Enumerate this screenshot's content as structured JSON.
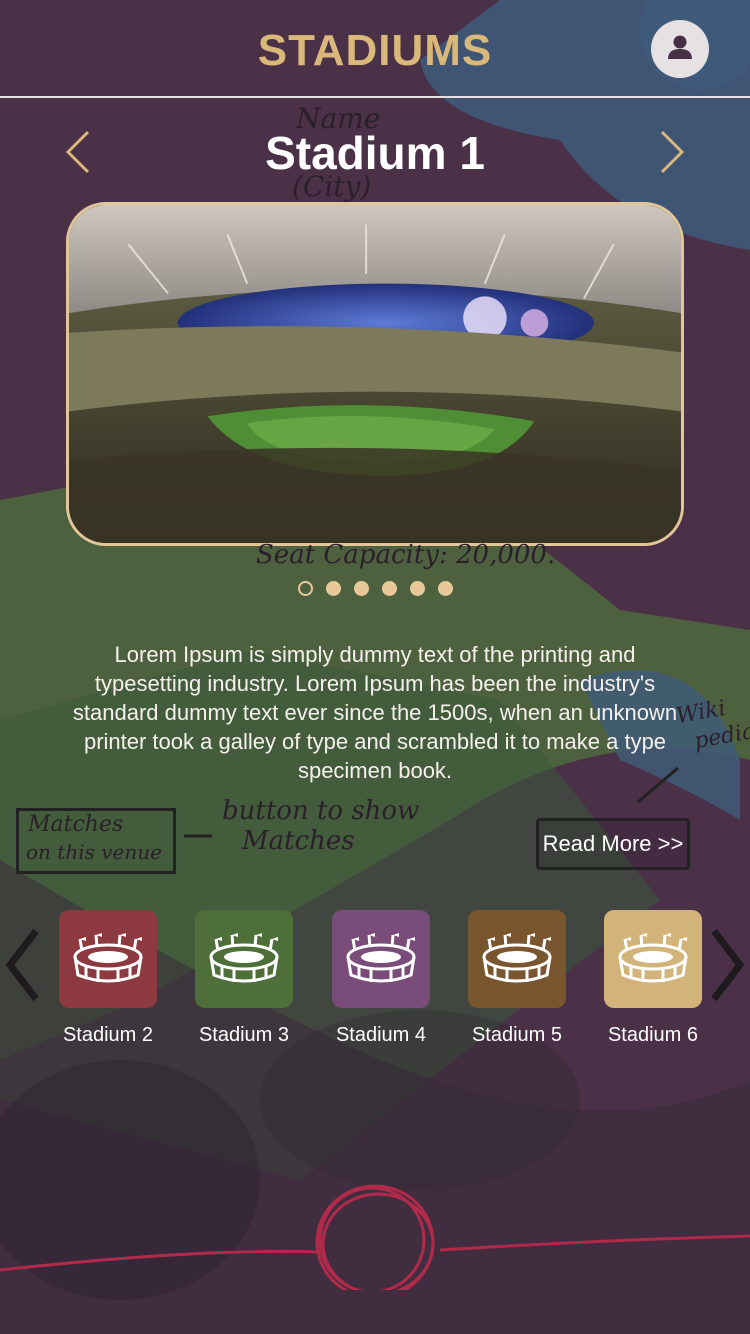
{
  "header": {
    "title": "STADIUMS",
    "avatar_icon": "user-icon"
  },
  "carousel": {
    "stadium_name": "Stadium 1",
    "prev_icon": "chevron-left-icon",
    "next_icon": "chevron-right-icon",
    "image_icon": "stadium-photo",
    "dots_total": 6,
    "active_dot": 1
  },
  "annotations": {
    "name": "Name",
    "city": "(City)",
    "seat_capacity": "Seat Capacity: 20,000.",
    "wiki_line1": "Wiki",
    "wiki_line2": "pedia",
    "button_note_line1": "button to show",
    "button_note_line2": "Matches",
    "matches_box_line1": "Matches",
    "matches_box_line2": "on this venue"
  },
  "description": "Lorem Ipsum is simply dummy text of the printing and typesetting industry. Lorem Ipsum has been the industry's standard dummy text ever since the 1500s, when an unknown printer took a galley of type and scrambled it to make a type specimen book.",
  "read_more_label": "Read More >>",
  "stadium_list": [
    {
      "label": "Stadium 2",
      "color": "#8c3a3f",
      "icon": "stadium-icon"
    },
    {
      "label": "Stadium 3",
      "color": "#4e6e3a",
      "icon": "stadium-icon"
    },
    {
      "label": "Stadium 4",
      "color": "#7a4c79",
      "icon": "stadium-icon"
    },
    {
      "label": "Stadium 5",
      "color": "#7a5630",
      "icon": "stadium-icon"
    },
    {
      "label": "Stadium 6",
      "color": "#d2b47a",
      "icon": "stadium-icon"
    }
  ],
  "colors": {
    "accent": "#d9b87a",
    "background": "#4a3047",
    "scribble": "#b22a4a"
  }
}
